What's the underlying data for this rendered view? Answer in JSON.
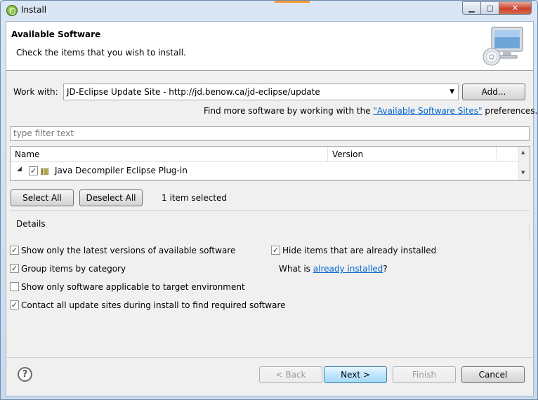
{
  "window": {
    "title": "Install",
    "minimize_glyph": "▁",
    "maximize_glyph": "▢",
    "close_glyph": "✕"
  },
  "banner": {
    "title": "Available Software",
    "description": "Check the items that you wish to install."
  },
  "work_with": {
    "label": "Work with:",
    "value": "JD-Eclipse Update Site - http://jd.benow.ca/jd-eclipse/update",
    "add_button": "Add..."
  },
  "find_more": {
    "prefix": "Find more software by working with the ",
    "link": "\"Available Software Sites\"",
    "suffix": " preferences."
  },
  "filter": {
    "placeholder": "type filter text"
  },
  "tree": {
    "columns": [
      "Name",
      "Version"
    ],
    "rows": [
      {
        "name": "Java Decompiler Eclipse Plug-in",
        "version": "",
        "checked": true
      }
    ]
  },
  "selection": {
    "select_all": "Select All",
    "deselect_all": "Deselect All",
    "status": "1 item selected"
  },
  "details": {
    "label": "Details"
  },
  "options": {
    "latest_versions": {
      "label": "Show only the latest versions of available software",
      "checked": true
    },
    "group_by_category": {
      "label": "Group items by category",
      "checked": true
    },
    "target_environment": {
      "label": "Show only software applicable to target environment",
      "checked": false
    },
    "contact_all_sites": {
      "label": "Contact all update sites during install to find required software",
      "checked": true
    },
    "hide_installed": {
      "label": "Hide items that are already installed",
      "checked": true
    },
    "what_is_prefix": "What is ",
    "what_is_link": "already installed",
    "what_is_suffix": "?"
  },
  "footer": {
    "help_glyph": "?",
    "back": "< Back",
    "next": "Next >",
    "finish": "Finish",
    "cancel": "Cancel"
  },
  "icons": {
    "app": "eclipse-icon",
    "banner": "monitor-cd-icon",
    "help": "help-icon",
    "package": "package-icon"
  }
}
